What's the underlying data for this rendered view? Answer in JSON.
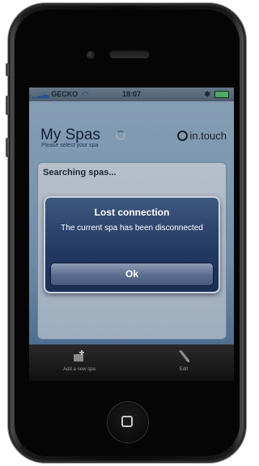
{
  "status_bar": {
    "carrier": "GECKO",
    "time": "18:07"
  },
  "header": {
    "title": "My Spas",
    "subtitle": "Please select your spa",
    "logo": "in.touch"
  },
  "panel": {
    "heading": "Searching spas..."
  },
  "alert": {
    "title": "Lost connection",
    "message": "The current spa has been disconnected",
    "button_label": "Ok"
  },
  "tabbar": {
    "items": [
      {
        "label": "Add a new spa",
        "icon": "add-spa-icon"
      },
      {
        "label": "Edit",
        "icon": "pencil-icon"
      }
    ]
  },
  "colors": {
    "alert_bg": "#233a63",
    "screen_bg": "#9bb9d1"
  }
}
